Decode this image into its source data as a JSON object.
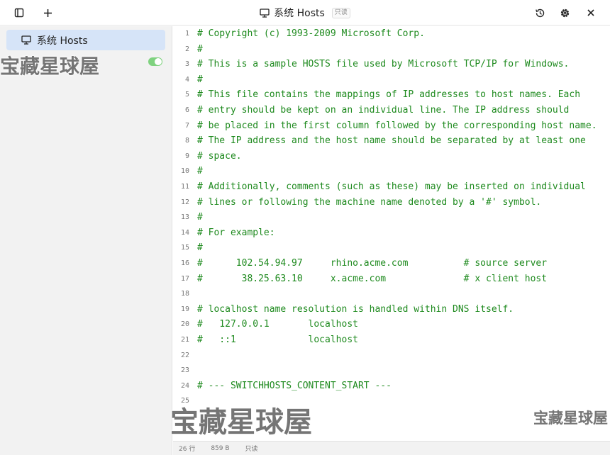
{
  "titlebar": {
    "title": "系统 Hosts",
    "readonly_badge": "只读"
  },
  "sidebar": {
    "items": [
      {
        "label": "系统 Hosts",
        "active": true
      }
    ],
    "toggle_on": true
  },
  "editor": {
    "lines": [
      {
        "n": "1",
        "text": "# Copyright (c) 1993-2009 Microsoft Corp."
      },
      {
        "n": "2",
        "text": "#"
      },
      {
        "n": "3",
        "text": "# This is a sample HOSTS file used by Microsoft TCP/IP for Windows."
      },
      {
        "n": "4",
        "text": "#"
      },
      {
        "n": "5",
        "text": "# This file contains the mappings of IP addresses to host names. Each"
      },
      {
        "n": "6",
        "text": "# entry should be kept on an individual line. The IP address should"
      },
      {
        "n": "7",
        "text": "# be placed in the first column followed by the corresponding host name."
      },
      {
        "n": "8",
        "text": "# The IP address and the host name should be separated by at least one"
      },
      {
        "n": "9",
        "text": "# space."
      },
      {
        "n": "10",
        "text": "#"
      },
      {
        "n": "11",
        "text": "# Additionally, comments (such as these) may be inserted on individual"
      },
      {
        "n": "12",
        "text": "# lines or following the machine name denoted by a '#' symbol."
      },
      {
        "n": "13",
        "text": "#"
      },
      {
        "n": "14",
        "text": "# For example:"
      },
      {
        "n": "15",
        "text": "#"
      },
      {
        "n": "16",
        "text": "#      102.54.94.97     rhino.acme.com          # source server"
      },
      {
        "n": "17",
        "text": "#       38.25.63.10     x.acme.com              # x client host"
      },
      {
        "n": "18",
        "text": ""
      },
      {
        "n": "19",
        "text": "# localhost name resolution is handled within DNS itself."
      },
      {
        "n": "20",
        "text": "#   127.0.0.1       localhost"
      },
      {
        "n": "21",
        "text": "#   ::1             localhost"
      },
      {
        "n": "22",
        "text": ""
      },
      {
        "n": "23",
        "text": ""
      },
      {
        "n": "24",
        "text": "# --- SWITCHHOSTS_CONTENT_START ---"
      },
      {
        "n": "25",
        "text": ""
      }
    ]
  },
  "statusbar": {
    "lines": "26 行",
    "size": "859 B",
    "mode": "只读"
  },
  "watermark": {
    "text": "宝藏星球屋"
  },
  "colors": {
    "code": "#1e8a1e",
    "active_item": "#d6e4f8",
    "toggle": "#7fd27f"
  },
  "icons": {
    "sidebar_toggle": "sidebar-toggle-icon",
    "add": "plus-icon",
    "monitor": "monitor-icon",
    "history": "history-icon",
    "settings": "gear-icon",
    "close": "close-icon"
  }
}
